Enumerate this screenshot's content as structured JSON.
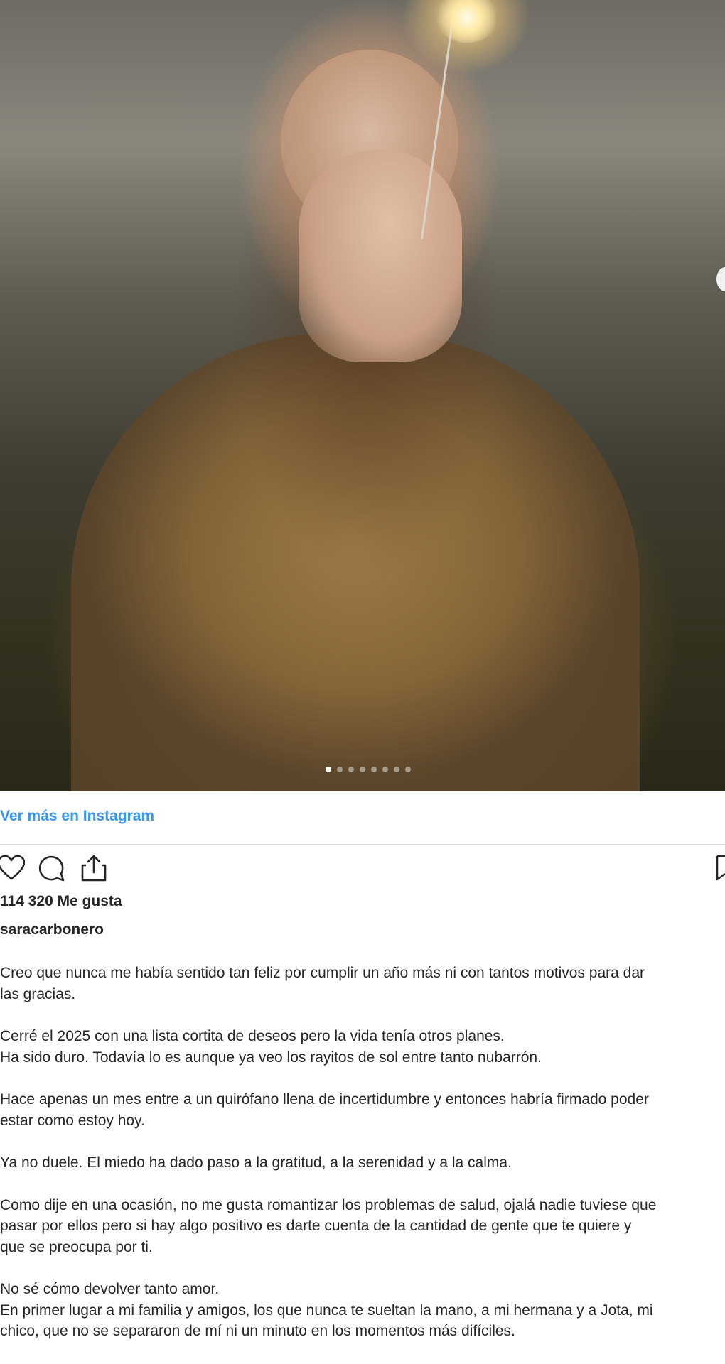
{
  "post": {
    "carousel": {
      "total": 8,
      "active_index": 0
    },
    "view_more_label": "Ver más en Instagram",
    "likes_text": "114 320 Me gusta",
    "username": "saracarbonero",
    "caption_lines": [
      "Creo que nunca me había sentido tan feliz por cumplir un año más ni con tantos motivos para dar",
      "las gracias.",
      "Cerré el 2025 con una lista cortita de deseos pero la vida tenía otros planes.",
      "Ha sido duro. Todavía lo es aunque ya veo los rayitos de sol entre tanto nubarrón.",
      "Hace apenas un mes entre a un quirófano llena de incertidumbre y entonces habría firmado poder",
      "estar como estoy hoy.",
      "Ya no duele. El miedo ha dado paso a la gratitud, a la serenidad y a la calma.",
      "Como dije en una ocasión, no me gusta romantizar los problemas de salud, ojalá nadie tuviese que",
      "pasar por ellos pero si hay algo positivo es darte cuenta de la cantidad de gente que te quiere y",
      "que se preocupa por ti.",
      "No sé cómo devolver tanto amor.",
      "En primer lugar a mi familia y amigos, los que nunca te sueltan la mano, a mi hermana y a Jota, mi",
      "chico, que no se separaron de mí ni un minuto en los momentos más difíciles."
    ]
  },
  "icons": {
    "like": "heart-icon",
    "comment": "comment-icon",
    "share": "share-icon",
    "save": "bookmark-icon"
  },
  "colors": {
    "link": "#3897f0",
    "text": "#262626",
    "divider": "#dbdbdb"
  }
}
